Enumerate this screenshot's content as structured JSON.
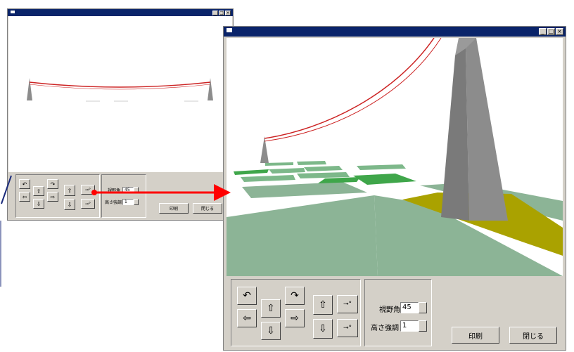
{
  "small_window": {
    "titlebar_buttons": [
      "_",
      "□",
      "×"
    ],
    "controls": {
      "fov_label": "視野角",
      "fov_value": "45",
      "height_label": "高さ強調",
      "height_value": "1",
      "print_button": "印刷",
      "close_button": "閉じる"
    }
  },
  "large_window": {
    "titlebar_buttons": [
      "_",
      "□",
      "×"
    ],
    "controls": {
      "fov_label": "視野角",
      "fov_value": "45",
      "height_label": "高さ強調",
      "height_value": "1",
      "print_button": "印刷",
      "close_button": "閉じる"
    }
  },
  "icons": [
    "rotate-left-icon",
    "arrow-up-icon",
    "rotate-right-icon",
    "arrow-left-icon",
    "arrow-right-icon",
    "arrow-down-icon",
    "move-forward-icon",
    "move-backward-icon",
    "zoom-in-icon",
    "zoom-out-icon"
  ],
  "colors": {
    "titlebar": "#0a246a",
    "power_line": "#cc2222",
    "tower": "#8c8c8c",
    "connector_arrow": "#ff0000",
    "field_green": "#8cb496",
    "bright_green": "#3fa64a",
    "olive": "#aaa200"
  }
}
